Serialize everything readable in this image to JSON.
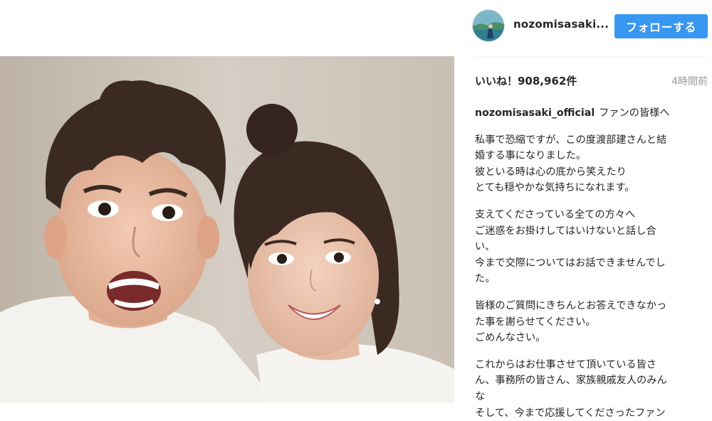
{
  "post": {
    "author_short": "nozomisasaki...",
    "follow_label": "フォローする",
    "likes_label": "いいね！908,962件",
    "time_ago": "4時間前",
    "caption_user": "nozomisasaki_official",
    "caption_first": "ファンの皆様へ",
    "paragraphs": [
      [
        "私事で恐縮ですが、この度渡部建さんと結",
        "婚する事になりました。",
        "彼といる時は心の底から笑えたり",
        "とても穏やかな気持ちになれます。"
      ],
      [
        "支えてくださっている全ての方々へ",
        "ご迷惑をお掛けしてはいけないと話し合",
        "い、",
        "今まで交際についてはお話できませんでし",
        "た。"
      ],
      [
        "皆様のご質問にきちんとお答えできなかっ",
        "た事を謝らせてください。",
        "ごめんなさい。"
      ],
      [
        "これからはお仕事させて頂いている皆さ",
        "ん、事務所の皆さん、家族親戚友人のみん",
        "な",
        "そして、今まで応援してくださったファン"
      ]
    ]
  },
  "colors": {
    "follow_button": "#3897f0",
    "muted_text": "#999999"
  }
}
